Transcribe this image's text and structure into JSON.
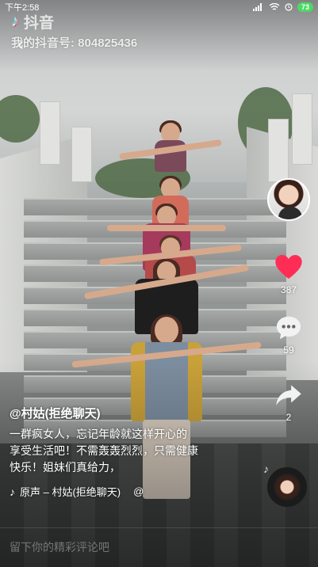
{
  "status_bar": {
    "time": "下午2:58",
    "battery": "73"
  },
  "watermark": {
    "app_name": "抖音",
    "user_id_label": "我的抖音号: 804825436"
  },
  "actions": {
    "likes": "387",
    "comments": "59",
    "shares": "2"
  },
  "caption": {
    "author": "@村姑(拒绝聊天)",
    "line1": "一群疯女人，忘记年龄就这样开心的",
    "line2": "享受生活吧！不需轰轰烈烈，只需健康",
    "line3": "快乐！姐妹们真给力，"
  },
  "music": {
    "track": "原声 – 村姑(拒绝聊天)",
    "extra": "@"
  },
  "comment_bar": {
    "placeholder": "留下你的精彩评论吧"
  },
  "colors": {
    "like_red": "#ff2d55",
    "battery_green": "#4cd964"
  },
  "icons": [
    "back-icon",
    "heart-icon",
    "comment-icon",
    "share-icon",
    "music-note-icon",
    "tiktok-logo-icon",
    "signal-icon",
    "wifi-icon"
  ]
}
